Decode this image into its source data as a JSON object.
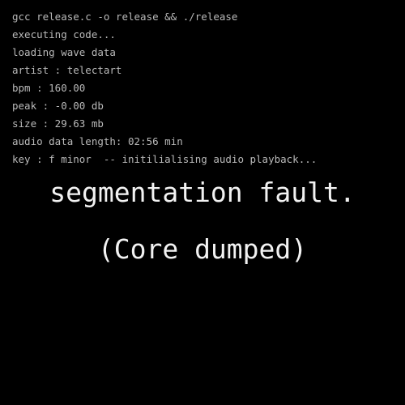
{
  "terminal": {
    "lines": [
      "gcc release.c -o release && ./release",
      "executing code...",
      "loading wave data",
      "artist : telectart",
      "bpm : 160.00",
      "peak : -0.00 db",
      "size : 29.63 mb",
      "audio data length: 02:56 min",
      "key : f minor  -- initilialising audio playback..."
    ]
  },
  "error": {
    "message": "segmentation fault.",
    "detail": "(Core dumped)"
  },
  "colors": {
    "background": "#000000",
    "terminal_text": "#b9b9b9",
    "error_text": "#f2f2f2"
  }
}
